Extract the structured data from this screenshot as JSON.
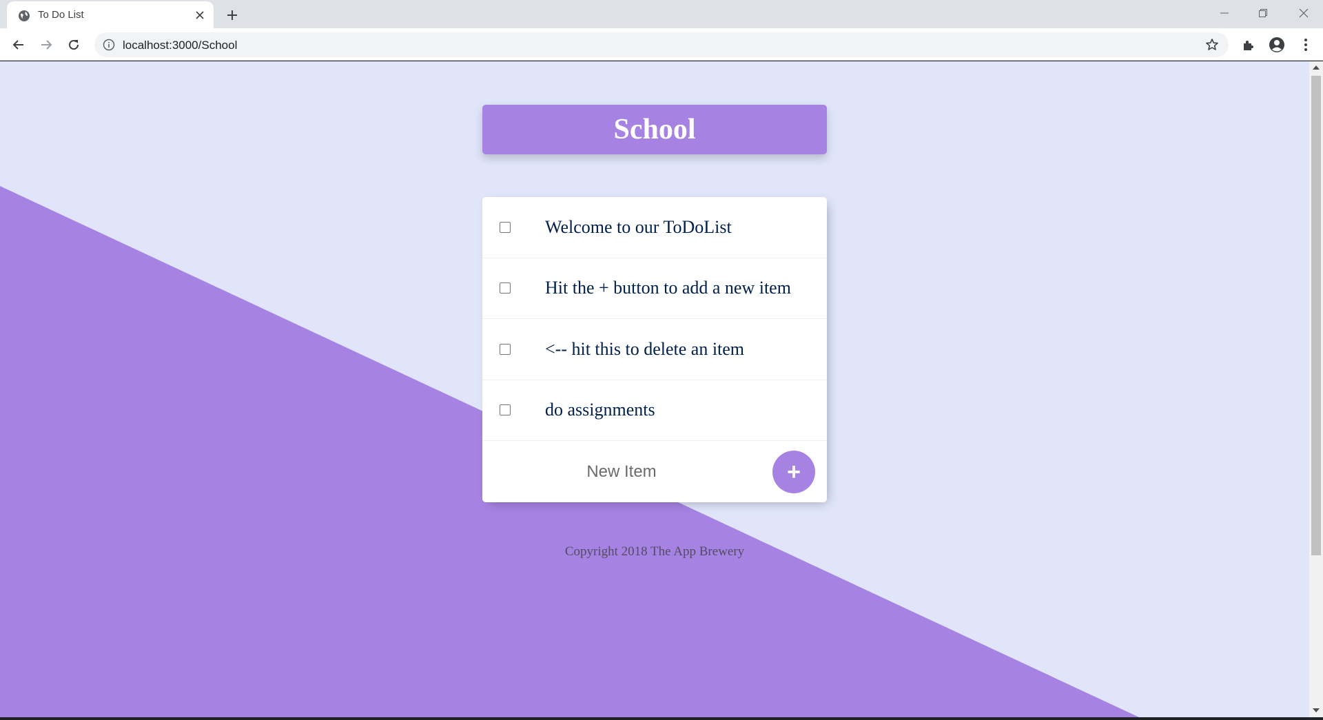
{
  "browser": {
    "tab_title": "To Do List",
    "url": "localhost:3000/School"
  },
  "page": {
    "list_title": "School",
    "items": [
      {
        "text": "Welcome to our ToDoList",
        "checked": false
      },
      {
        "text": "Hit the + button to add a new item",
        "checked": false
      },
      {
        "text": "<-- hit this to delete an item",
        "checked": false
      },
      {
        "text": "do assignments",
        "checked": false
      }
    ],
    "new_item_placeholder": "New Item",
    "add_button_label": "+",
    "footer": "Copyright 2018 The App Brewery"
  },
  "colors": {
    "accent": "#a683e3",
    "background": "#e0e5fa",
    "item_text": "#00204a"
  },
  "icons": [
    "globe-favicon-icon",
    "close-icon",
    "plus-icon",
    "minimize-icon",
    "restore-icon",
    "back-icon",
    "forward-icon",
    "reload-icon",
    "info-icon",
    "star-icon",
    "extensions-icon",
    "profile-icon",
    "menu-icon"
  ]
}
